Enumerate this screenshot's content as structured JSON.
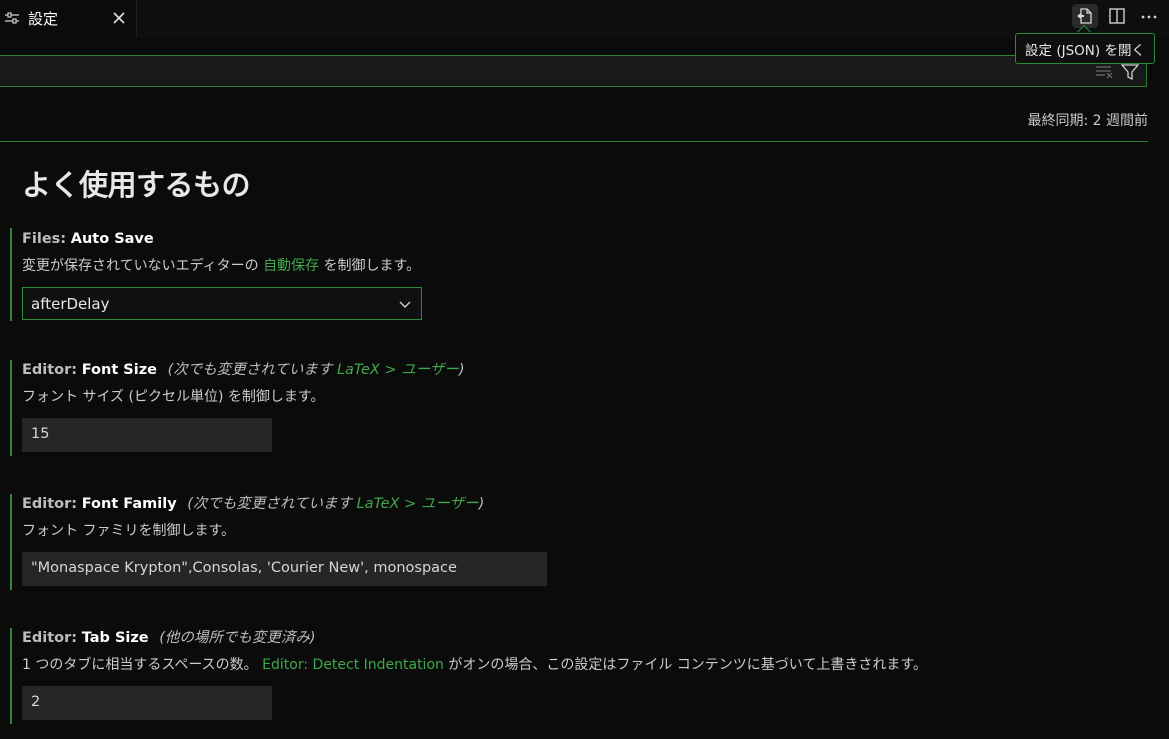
{
  "tab": {
    "label": "設定",
    "icon": "settings-sliders-icon",
    "close_icon": "close-icon"
  },
  "actions": {
    "open_json_icon": "open-json-icon",
    "split_editor_icon": "split-editor-icon",
    "more_icon": "more-actions-icon",
    "tooltip": "設定 (JSON) を開く"
  },
  "search": {
    "value": "",
    "clear_icon": "clear-filter-icon",
    "filter_icon": "filter-icon"
  },
  "sync_status": "最終同期: 2 週間前",
  "section_title": "よく使用するもの",
  "settings": [
    {
      "category": "Files:",
      "key": "Auto Save",
      "description_before": "変更が保存されていないエディターの",
      "description_link": "自動保存",
      "description_after": "を制御します。",
      "value": "afterDelay"
    },
    {
      "category": "Editor:",
      "key": "Font Size",
      "note_before": "(次でも変更されています",
      "note_link": "LaTeX > ユーザー",
      "note_after": ")",
      "description": "フォント サイズ (ピクセル単位) を制御します。",
      "value": "15"
    },
    {
      "category": "Editor:",
      "key": "Font Family",
      "note_before": "(次でも変更されています",
      "note_link": "LaTeX > ユーザー",
      "note_after": ")",
      "description": "フォント ファミリを制御します。",
      "value": "\"Monaspace Krypton\",Consolas, 'Courier New', monospace"
    },
    {
      "category": "Editor:",
      "key": "Tab Size",
      "note": "(他の場所でも変更済み)",
      "description_before": "1 つのタブに相当するスペースの数。",
      "description_link": "Editor: Detect Indentation",
      "description_after": "がオンの場合、この設定はファイル コンテンツに基づいて上書きされます。",
      "value": "2"
    }
  ],
  "colors": {
    "accent": "#2e8a3a",
    "link": "#3fa84a",
    "background": "#0b0b0b"
  }
}
